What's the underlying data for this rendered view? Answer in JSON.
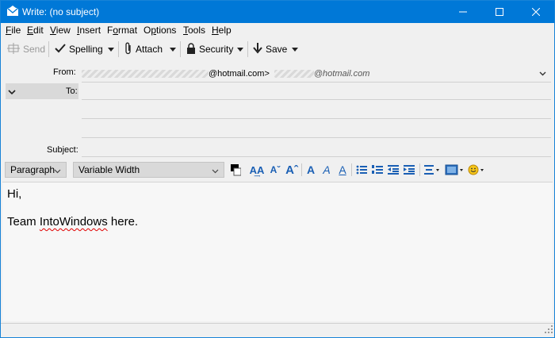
{
  "window": {
    "title": "Write: (no subject)"
  },
  "menu": [
    {
      "accel": "F",
      "rest": "ile"
    },
    {
      "accel": "E",
      "rest": "dit"
    },
    {
      "accel": "V",
      "rest": "iew"
    },
    {
      "accel": "I",
      "rest": "nsert"
    },
    {
      "pre": "F",
      "accel": "o",
      "rest": "rmat"
    },
    {
      "pre": "O",
      "accel": "p",
      "rest": "tions"
    },
    {
      "accel": "T",
      "rest": "ools"
    },
    {
      "accel": "H",
      "rest": "elp"
    }
  ],
  "toolbar": {
    "send_label": "Send",
    "spelling_label": "Spelling",
    "attach_label": "Attach",
    "security_label": "Security",
    "save_label": "Save"
  },
  "headers": {
    "from_label": "From:",
    "from_visible_1": "@hotmail.com>",
    "from_visible_2": "@hotmail.com",
    "to_label": "To:",
    "subject_label": "Subject:"
  },
  "format": {
    "paragraph_label": "Paragraph",
    "font_label": "Variable Width"
  },
  "body": {
    "line1": "Hi,",
    "line2_pre": "Team ",
    "line2_misspelled": "IntoWindows",
    "line2_post": " here."
  },
  "colors": {
    "titlebar": "#0078d7",
    "format_icons": "#1a5fb4"
  }
}
